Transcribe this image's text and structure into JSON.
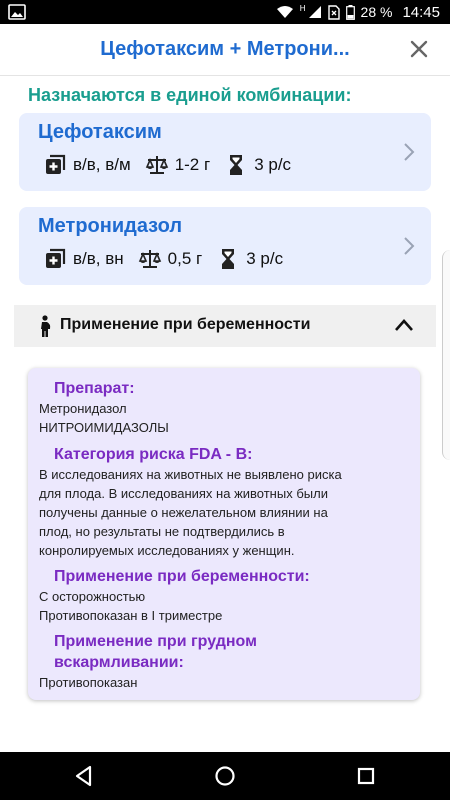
{
  "status_bar": {
    "network_label": "H",
    "battery": "28 %",
    "time": "14:45"
  },
  "header": {
    "title": "Цефотаксим + Метрони...",
    "close_icon": "close-icon"
  },
  "combination_heading": "Назначаются в единой комбинации:",
  "drugs": [
    {
      "name": "Цефотаксим",
      "route": "в/в, в/м",
      "dose": "1-2 г",
      "frequency": "3 р/с"
    },
    {
      "name": "Метронидазол",
      "route": "в/в, вн",
      "dose": "0,5 г",
      "frequency": "3 р/с"
    }
  ],
  "pregnancy_section": {
    "label": "Применение при беременности",
    "expanded": true
  },
  "info": {
    "drug_heading": "Препарат:",
    "drug_name": "Метронидазол",
    "drug_group": "НИТРОИМИДАЗОЛЫ",
    "fda_heading": "Категория риска FDA - B:",
    "fda_lines": [
      "В исследованиях на животных не выявлено риска",
      "для плода. В исследованиях на животных были",
      "получены данные о нежелательном влиянии на",
      "плод, но результаты не подтвердились в",
      "конролируемых исследованиях у женщин."
    ],
    "pregnancy_heading": "Применение при беременности:",
    "pregnancy_lines": [
      "С осторожностью",
      "Противопоказан в I триместре"
    ],
    "lactation_heading_lines": [
      "Применение при грудном",
      "вскармливании:"
    ],
    "lactation_text": "Противопоказан"
  },
  "colors": {
    "title_blue": "#1f6bd0",
    "heading_teal": "#1a9e8f",
    "card_bg": "#e8eefe",
    "info_bg": "#ece8fd",
    "info_heading_purple": "#7a2bc2"
  }
}
